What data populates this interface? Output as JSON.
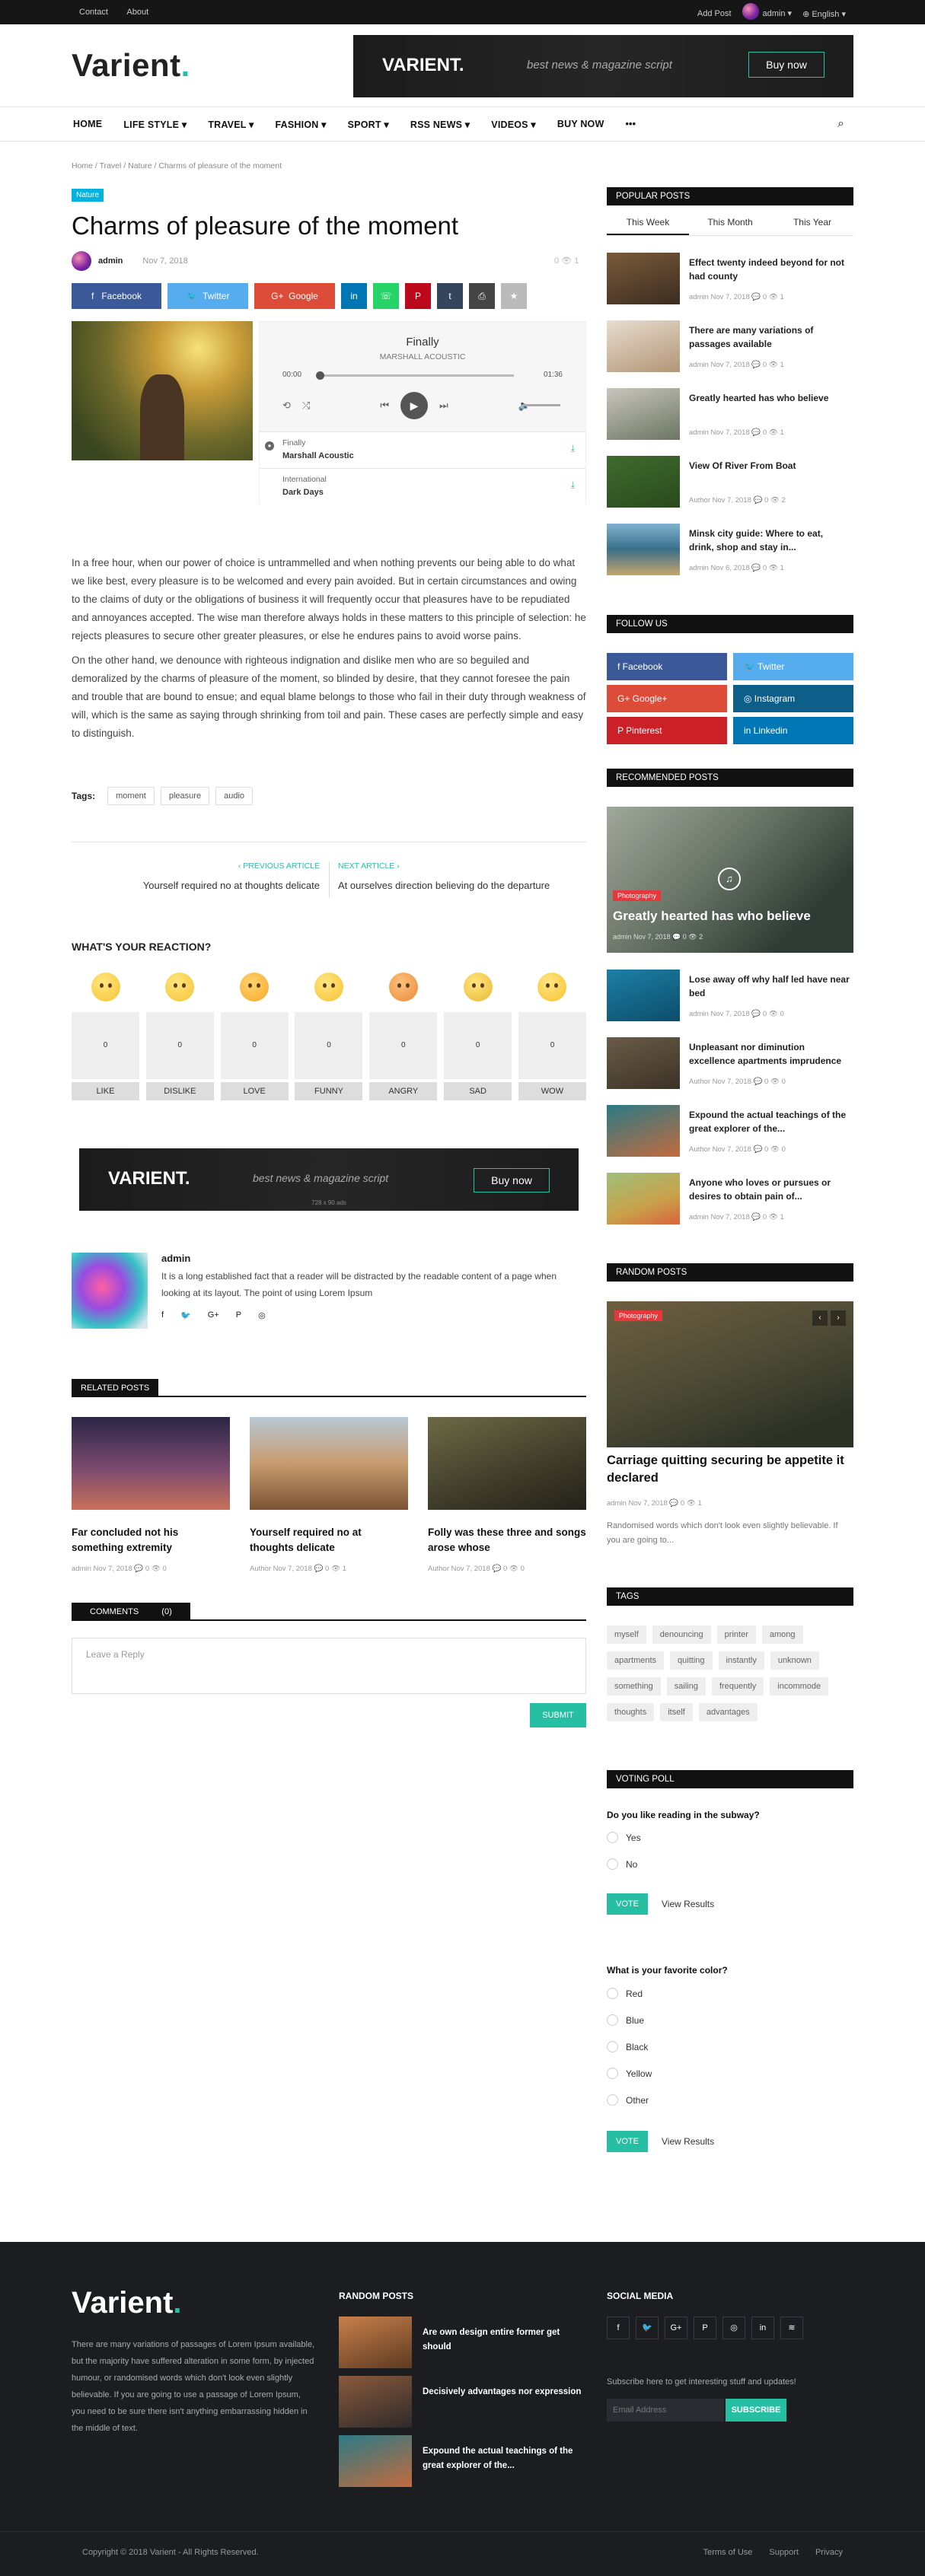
{
  "topbar": {
    "links": [
      "Contact",
      "About"
    ],
    "add_post": "Add Post",
    "user": "admin ▾",
    "lang": "⊕ English ▾"
  },
  "header": {
    "logo": "Varient",
    "logo_dot": ".",
    "banner_logo": "VARIENT.",
    "banner_tagline": "best news & magazine script",
    "banner_button": "Buy now",
    "banner_size": "728 x 90 ads"
  },
  "nav": [
    "HOME",
    "LIFE STYLE ▾",
    "TRAVEL ▾",
    "FASHION ▾",
    "SPORT ▾",
    "RSS NEWS ▾",
    "VIDEOS ▾",
    "BUY NOW",
    "•••"
  ],
  "breadcrumb": "Home / Travel / Nature / Charms of pleasure of the moment",
  "article": {
    "category": "Nature",
    "title": "Charms of pleasure of the moment",
    "author": "admin",
    "date": "Nov 7, 2018",
    "meta_right": "0   👁 1",
    "share": {
      "facebook": "Facebook",
      "twitter": "Twitter",
      "google": "Google"
    },
    "player": {
      "title": "Finally",
      "artist": "MARSHALL ACOUSTIC",
      "time_start": "00:00",
      "time_end": "01:36",
      "tracks": [
        {
          "name": "Finally",
          "artist": "Marshall Acoustic"
        },
        {
          "name": "International",
          "artist": "Dark Days"
        }
      ]
    },
    "paragraphs": [
      "In a free hour, when our power of choice is untrammelled and when nothing prevents our being able to do what we like best, every pleasure is to be welcomed and every pain avoided. But in certain circumstances and owing to the claims of duty or the obligations of business it will frequently occur that pleasures have to be repudiated and annoyances accepted. The wise man therefore always holds in these matters to this principle of selection: he rejects pleasures to secure other greater pleasures, or else he endures pains to avoid worse pains.",
      "On the other hand, we denounce with righteous indignation and dislike men who are so beguiled and demoralized by the charms of pleasure of the moment, so blinded by desire, that they cannot foresee the pain and trouble that are bound to ensue; and equal blame belongs to those who fail in their duty through weakness of will, which is the same as saying through shrinking from toil and pain. These cases are perfectly simple and easy to distinguish."
    ],
    "tags_label": "Tags:",
    "tags": [
      "moment",
      "pleasure",
      "audio"
    ],
    "prev_label": "‹  PREVIOUS ARTICLE",
    "prev_title": "Yourself required no at thoughts delicate",
    "next_label": "NEXT ARTICLE  ›",
    "next_title": "At ourselves direction believing do the departure"
  },
  "reactions": {
    "heading": "WHAT'S YOUR REACTION?",
    "items": [
      {
        "label": "LIKE",
        "count": "0"
      },
      {
        "label": "DISLIKE",
        "count": "0"
      },
      {
        "label": "LOVE",
        "count": "0"
      },
      {
        "label": "FUNNY",
        "count": "0"
      },
      {
        "label": "ANGRY",
        "count": "0"
      },
      {
        "label": "SAD",
        "count": "0"
      },
      {
        "label": "WOW",
        "count": "0"
      }
    ]
  },
  "author_box": {
    "name": "admin",
    "bio": "It is a long established fact that a reader will be distracted by the readable content of a page when looking at its layout. The point of using Lorem Ipsum"
  },
  "related": {
    "heading": "RELATED POSTS",
    "posts": [
      {
        "title": "Far concluded not his something extremity",
        "meta": "admin   Nov 7, 2018   💬 0   👁 0"
      },
      {
        "title": "Yourself required no at thoughts delicate",
        "meta": "Author   Nov 7, 2018   💬 0   👁 1"
      },
      {
        "title": "Folly was these three and songs arose whose",
        "meta": "Author   Nov 7, 2018   💬 0   👁 0"
      }
    ]
  },
  "comments": {
    "heading": "COMMENTS",
    "count": "(0)",
    "placeholder": "Leave a Reply",
    "submit": "SUBMIT"
  },
  "sidebar": {
    "popular": {
      "heading": "POPULAR POSTS",
      "tabs": [
        "This Week",
        "This Month",
        "This Year"
      ],
      "posts": [
        {
          "title": "Effect twenty indeed beyond for not had county",
          "meta": "admin   Nov 7, 2018   💬 0   👁 1"
        },
        {
          "title": "There are many variations of passages available",
          "meta": "admin   Nov 7, 2018   💬 0   👁 1"
        },
        {
          "title": "Greatly hearted has who believe",
          "meta": "admin   Nov 7, 2018   💬 0   👁 1"
        },
        {
          "title": "View Of River From Boat",
          "meta": "Author   Nov 7, 2018   💬 0   👁 2"
        },
        {
          "title": "Minsk city guide: Where to eat, drink, shop and stay in...",
          "meta": "admin   Nov 6, 2018   💬 0   👁 1"
        }
      ]
    },
    "follow": {
      "heading": "FOLLOW US",
      "items": [
        "f   Facebook",
        "🐦   Twitter",
        "G+   Google+",
        "◎   Instagram",
        "P   Pinterest",
        "in   Linkedin"
      ]
    },
    "recommended": {
      "heading": "RECOMMENDED POSTS",
      "featured": {
        "category": "Photography",
        "title": "Greatly hearted has who believe",
        "meta": "admin   Nov 7, 2018   💬 0   👁 2"
      },
      "posts": [
        {
          "title": "Lose away off why half led have near bed",
          "meta": "admin   Nov 7, 2018   💬 0   👁 0"
        },
        {
          "title": "Unpleasant nor diminution excellence apartments imprudence",
          "meta": "Author   Nov 7, 2018   💬 0   👁 0"
        },
        {
          "title": "Expound the actual teachings of the great explorer of the...",
          "meta": "Author   Nov 7, 2018   💬 0   👁 0"
        },
        {
          "title": "Anyone who loves or pursues or desires to obtain pain of...",
          "meta": "admin   Nov 7, 2018   💬 0   👁 1"
        }
      ]
    },
    "random": {
      "heading": "RANDOM POSTS",
      "category": "Photography",
      "title": "Carriage quitting securing be appetite it declared",
      "meta": "admin   Nov 7, 2018   💬 0   👁 1",
      "excerpt": "Randomised words which don't look even slightly believable. If you are going to..."
    },
    "tags": {
      "heading": "TAGS",
      "items": [
        "myself",
        "denouncing",
        "printer",
        "among",
        "apartments",
        "quitting",
        "instantly",
        "unknown",
        "something",
        "sailing",
        "frequently",
        "incommode",
        "thoughts",
        "itself",
        "advantages"
      ]
    },
    "poll": {
      "heading": "VOTING POLL",
      "q1": "Do you like reading in the subway?",
      "q1_options": [
        "Yes",
        "No"
      ],
      "q2": "What is your favorite color?",
      "q2_options": [
        "Red",
        "Blue",
        "Black",
        "Yellow",
        "Other"
      ],
      "vote": "VOTE",
      "view_results": "View Results"
    }
  },
  "footer": {
    "logo": "Varient",
    "desc": "There are many variations of passages of Lorem Ipsum available, but the majority have suffered alteration in some form, by injected humour, or randomised words which don't look even slightly believable. If you are going to use a passage of Lorem Ipsum, you need to be sure there isn't anything embarrassing hidden in the middle of text.",
    "random_heading": "RANDOM POSTS",
    "random_posts": [
      "Are own design entire former get should",
      "Decisively advantages nor expression",
      "Expound the actual teachings of the great explorer of the..."
    ],
    "social_heading": "SOCIAL MEDIA",
    "subscribe_text": "Subscribe here to get interesting stuff and updates!",
    "email_placeholder": "Email Address",
    "subscribe_button": "SUBSCRIBE",
    "copyright": "Copyright © 2018 Varient - All Rights Reserved.",
    "links": [
      "Terms of Use",
      "Support",
      "Privacy"
    ]
  }
}
